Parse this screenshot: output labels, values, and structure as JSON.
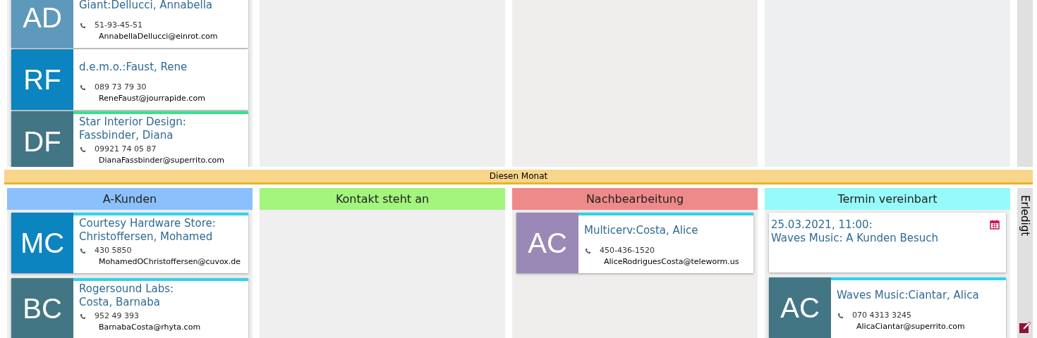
{
  "top": {
    "columns": [
      {
        "cards": [
          {
            "kind": "contact",
            "initials": "AD",
            "color": "#5e98bb",
            "name": [
              "Giant:Dellucci, Annabella"
            ],
            "phone": "51-93-45-51",
            "email": "AnnabellaDellucci@einrot.com"
          },
          {
            "kind": "contact",
            "initials": "RF",
            "color": "#0b84bf",
            "name": [
              "d.e.m.o.:Faust, Rene"
            ],
            "phone": "089 73 79 30",
            "email": "ReneFaust@jourrapide.com"
          },
          {
            "kind": "contact",
            "initials": "DF",
            "color": "#427685",
            "stripe": {
              "color": "#2ee68a"
            },
            "name": [
              "Star Interior Design:",
              "Fassbinder, Diana"
            ],
            "phone": "09921 74 05 87",
            "email": "DianaFassbinder@superrito.com"
          }
        ]
      },
      {},
      {},
      {}
    ]
  },
  "banner": "Diesen Monat",
  "bottom": {
    "columns": [
      {
        "title": "A-Kunden",
        "color": "#8cc0fc",
        "cards": [
          {
            "kind": "contact",
            "initials": "MC",
            "color": "#0b84bf",
            "stripe": {
              "color": "#2fd3ea"
            },
            "name": [
              "Courtesy Hardware Store:",
              "Christoffersen, Mohamed"
            ],
            "phone": "430 5850",
            "email": "MohamedOChristoffersen@cuvox.de"
          },
          {
            "kind": "contact",
            "initials": "BC",
            "color": "#427685",
            "stripe": {
              "color": "#2fd3ea"
            },
            "name": [
              "Rogersound Labs:",
              "Costa, Barnaba"
            ],
            "phone": "952 49 393",
            "email": "BarnabaCosta@rhyta.com"
          }
        ]
      },
      {
        "title": "Kontakt steht an",
        "color": "#a3f57d"
      },
      {
        "title": "Nachbearbeitung",
        "color": "#ef8a8a",
        "cards": [
          {
            "kind": "contact",
            "initials": "AC",
            "color": "#9a88b6",
            "stripe": {
              "color": "#2fd3ea"
            },
            "name": [
              "Multicerv:Costa, Alice"
            ],
            "phone": "450-436-1520",
            "email": "AliceRodriguesCosta@teleworm.us"
          }
        ]
      },
      {
        "title": "Termin vereinbart",
        "color": "#96fafa",
        "cards": [
          {
            "kind": "appointment",
            "date": "25.03.2021, 11:00:",
            "subject": "Waves Music: A Kunden Besuch"
          },
          {
            "kind": "contact",
            "initials": "AC",
            "color": "#427685",
            "stripe": {
              "color": "#2fd3ea"
            },
            "name": [
              "Waves Music:Ciantar, Alica"
            ],
            "phone": "070 4313 3245",
            "email": "AlicaCiantar@superrito.com"
          }
        ]
      }
    ]
  },
  "side": {
    "label": "Erledigt"
  }
}
